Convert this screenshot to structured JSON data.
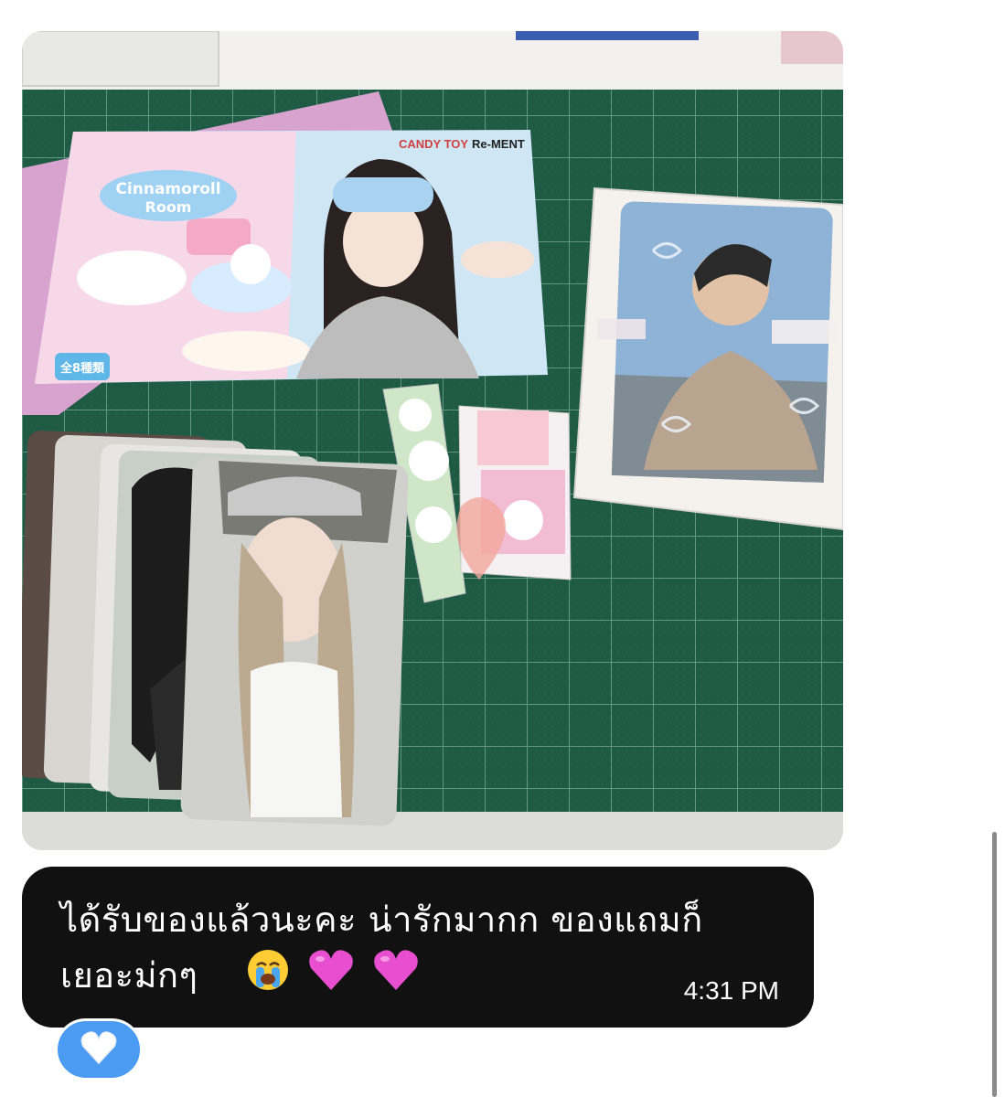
{
  "message": {
    "text_line1": "ได้รับของแล้วนะคะ น่ารักมากก ของแถมก็",
    "text_line2": "เยอะม่กๆ",
    "emojis": [
      "loudly-crying-face",
      "purple-heart",
      "purple-heart"
    ],
    "timestamp": "4:31 PM"
  },
  "reaction": {
    "emoji": "white-heart",
    "color": "#4c9bf3"
  },
  "photo": {
    "card_brand": "CANDY TOY",
    "card_brand2": "Re-MENT",
    "product_title_line1": "Cinnamoroll",
    "product_title_line2": "Room",
    "badge": "全8種類",
    "mat_color": "#1f5a44"
  }
}
